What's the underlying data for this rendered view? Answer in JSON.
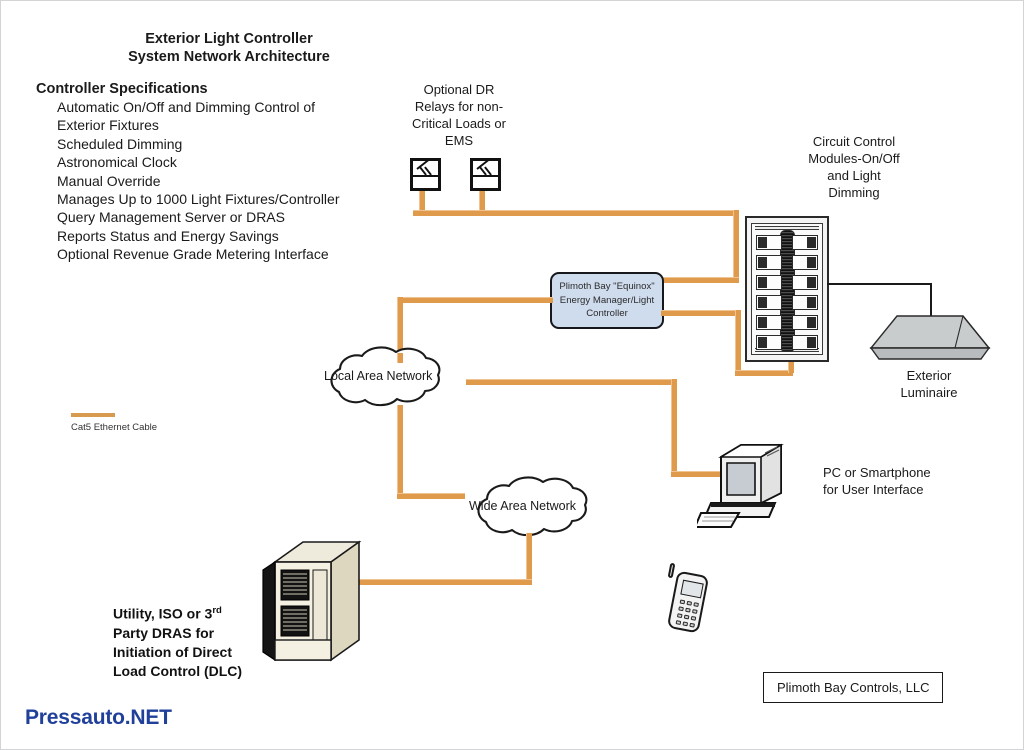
{
  "diagram": {
    "title_line1": "Exterior Light Controller",
    "title_line2": "System Network Architecture",
    "specs_heading": "Controller Specifications",
    "specs": [
      "Automatic On/Off and Dimming Control of",
      "Exterior Fixtures",
      "Scheduled Dimming",
      "Astronomical Clock",
      "Manual Override",
      "Manages Up to 1000 Light Fixtures/Controller",
      "Query Management Server or DRAS",
      "Reports Status and Energy Savings",
      "Optional Revenue Grade Metering Interface"
    ],
    "legend": {
      "cable_label": "Cat5 Ethernet Cable",
      "cable_color": "#d89a4f"
    },
    "nodes": {
      "relays_label_l1": "Optional DR",
      "relays_label_l2": "Relays for non-",
      "relays_label_l3": "Critical Loads or",
      "relays_label_l4": "EMS",
      "controller_l1": "Plimoth Bay \"Equinox\"",
      "controller_l2": "Energy Manager/Light",
      "controller_l3": "Controller",
      "panel_l1": "Circuit Control",
      "panel_l2": "Modules-On/Off",
      "panel_l3": "and Light",
      "panel_l4": "Dimming",
      "luminaire_l1": "Exterior",
      "luminaire_l2": "Luminaire",
      "lan": "Local Area Network",
      "wan": "Wide Area Network",
      "pc_l1": "PC or Smartphone",
      "pc_l2": "for User Interface",
      "dras_l1": "Utility, ISO or 3",
      "dras_l1_sup": "rd",
      "dras_l2": "Party DRAS for",
      "dras_l3": "Initiation of Direct",
      "dras_l4": "Load Control (DLC)"
    },
    "company_box": "Plimoth Bay Controls, LLC",
    "watermark": "Pressauto.NET",
    "colors": {
      "ethernet_orange": "#e09a4c",
      "controller_fill": "#cfdcee",
      "luminaire_gray": "#c3c6c8",
      "server_cream": "#e6e0cc",
      "watermark_blue": "#20409a"
    }
  }
}
